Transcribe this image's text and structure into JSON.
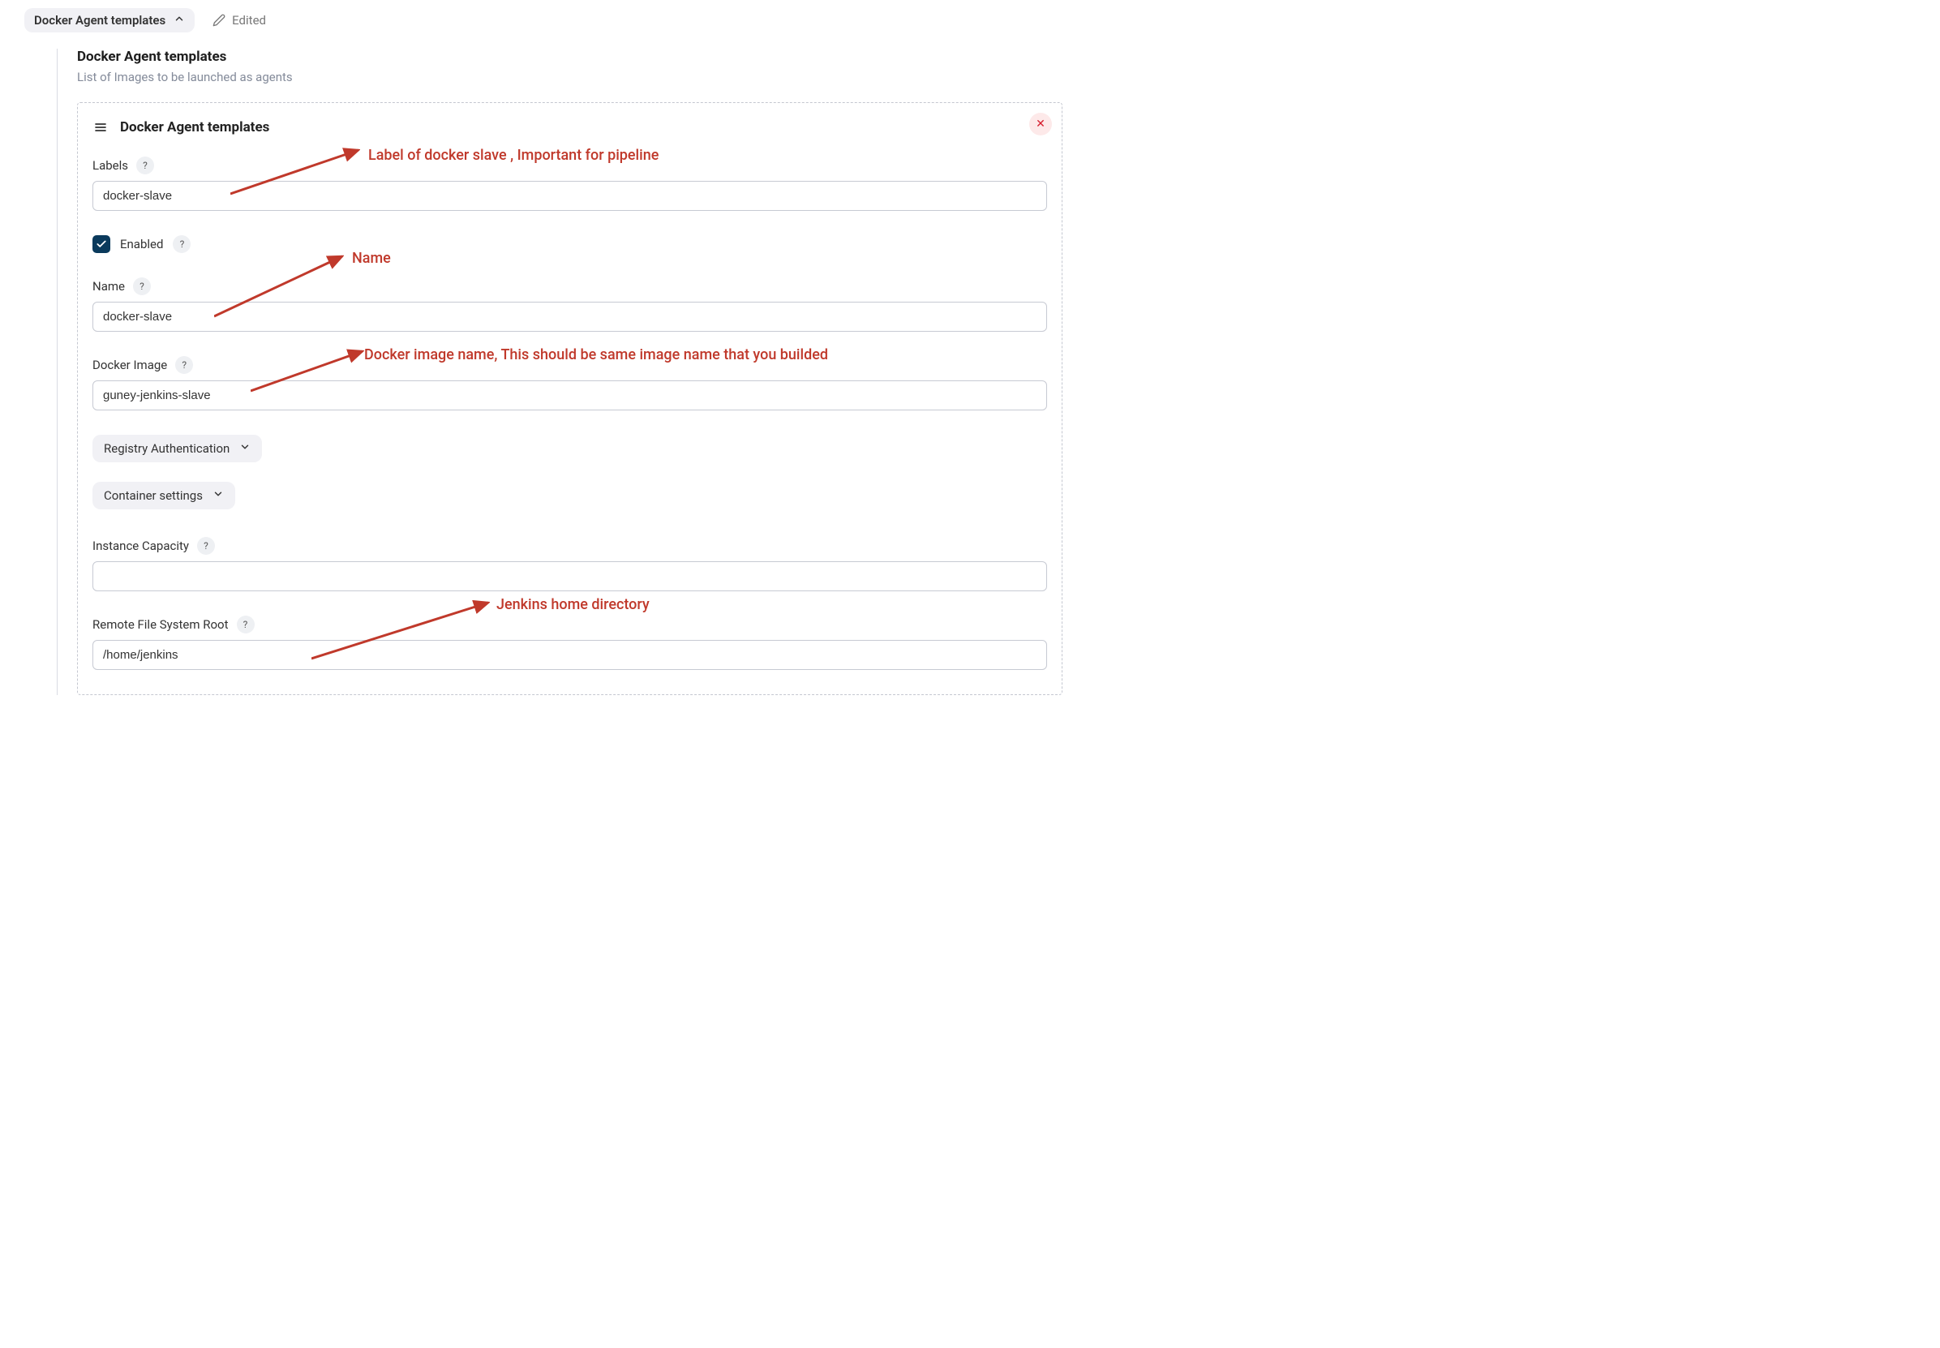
{
  "topbar": {
    "breadcrumb": "Docker Agent templates",
    "edited": "Edited"
  },
  "section": {
    "title": "Docker Agent templates",
    "subtitle": "List of Images to be launched as agents"
  },
  "panel": {
    "title": "Docker Agent templates"
  },
  "form": {
    "labels": {
      "label": "Labels",
      "value": "docker-slave"
    },
    "enabled": {
      "label": "Enabled",
      "checked": true
    },
    "name": {
      "label": "Name",
      "value": "docker-slave"
    },
    "docker_image": {
      "label": "Docker Image",
      "value": "guney-jenkins-slave"
    },
    "registry_auth": {
      "label": "Registry Authentication"
    },
    "container_settings": {
      "label": "Container settings"
    },
    "instance_capacity": {
      "label": "Instance Capacity",
      "value": ""
    },
    "remote_fs_root": {
      "label": "Remote File System Root",
      "value": "/home/jenkins"
    }
  },
  "annotations": {
    "labels": "Label of docker slave , Important for pipeline",
    "name": "Name",
    "docker_image": "Docker image name, This should be same image name that you builded",
    "remote_fs": "Jenkins home directory"
  }
}
